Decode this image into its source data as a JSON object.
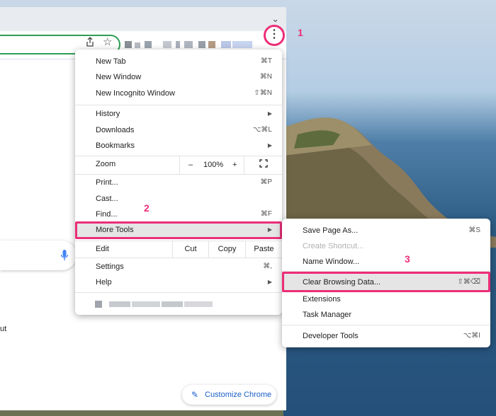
{
  "menu": {
    "items": [
      {
        "label": "New Tab",
        "shortcut": "⌘T"
      },
      {
        "label": "New Window",
        "shortcut": "⌘N"
      },
      {
        "label": "New Incognito Window",
        "shortcut": "⇧⌘N"
      },
      {
        "label": "History",
        "submenu": true
      },
      {
        "label": "Downloads",
        "shortcut": "⌥⌘L"
      },
      {
        "label": "Bookmarks",
        "submenu": true
      },
      {
        "label": "Zoom"
      },
      {
        "label": "Print...",
        "shortcut": "⌘P"
      },
      {
        "label": "Cast..."
      },
      {
        "label": "Find...",
        "shortcut": "⌘F"
      },
      {
        "label": "More Tools",
        "submenu": true
      },
      {
        "label": "Edit"
      },
      {
        "label": "Settings",
        "shortcut": "⌘,"
      },
      {
        "label": "Help",
        "submenu": true
      }
    ],
    "zoom": {
      "minus": "–",
      "value": "100%",
      "plus": "+"
    },
    "edit": {
      "cut": "Cut",
      "copy": "Copy",
      "paste": "Paste"
    },
    "arrow_glyph": "▶"
  },
  "submenu": {
    "items": [
      {
        "label": "Save Page As...",
        "shortcut": "⌘S"
      },
      {
        "label": "Create Shortcut...",
        "disabled": true
      },
      {
        "label": "Name Window..."
      },
      {
        "label": "Clear Browsing Data...",
        "shortcut": "⇧⌘⌫"
      },
      {
        "label": "Extensions"
      },
      {
        "label": "Task Manager"
      },
      {
        "label": "Developer Tools",
        "shortcut": "⌥⌘I"
      }
    ]
  },
  "toolbar": {
    "menu_glyph": "⋮",
    "share_icon": "share-icon",
    "star_icon": "star-icon",
    "tab_chevron": "⌄"
  },
  "page": {
    "fragment_text": "ut",
    "customize_label": "Customize Chrome"
  },
  "steps": {
    "one": "1",
    "two": "2",
    "three": "3"
  },
  "colors": {
    "highlight": "#ec2e78",
    "link": "#1a5fc8",
    "omnibox_border": "#2e9e56"
  }
}
